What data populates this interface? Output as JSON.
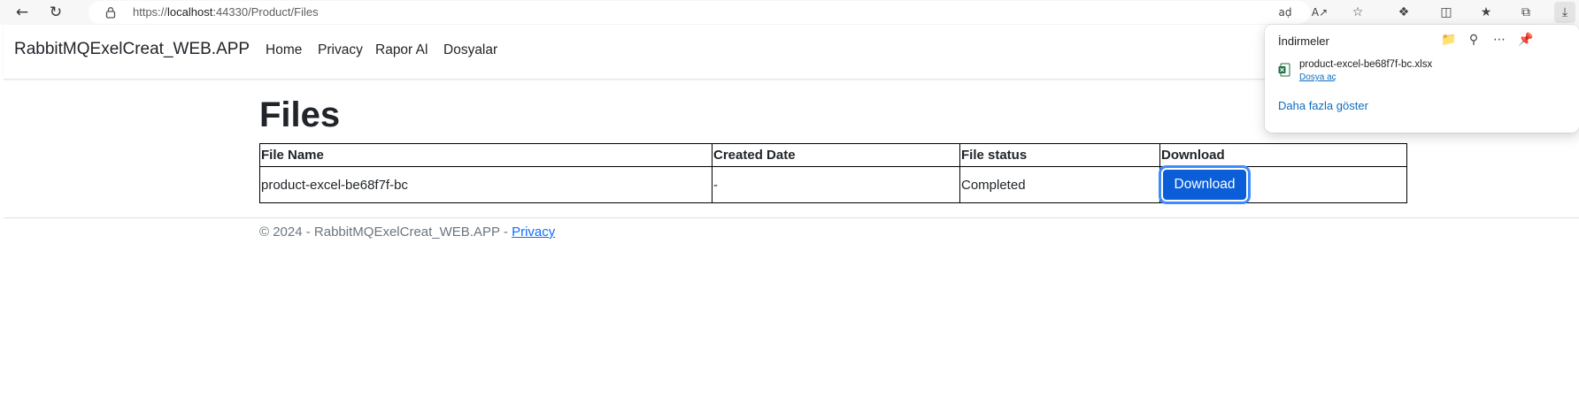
{
  "browser": {
    "url_prefix": "https://",
    "url_host": "localhost",
    "url_path": ":44330/Product/Files"
  },
  "navbar": {
    "brand": "RabbitMQExelCreat_WEB.APP",
    "links": [
      "Home",
      "Privacy",
      "Rapor Al",
      "Dosyalar"
    ]
  },
  "main": {
    "title": "Files",
    "table": {
      "headers": [
        "File Name",
        "Created Date",
        "File status",
        "Download"
      ],
      "rows": [
        {
          "file_name": "product-excel-be68f7f-bc",
          "created_date": "-",
          "status": "Completed",
          "download_label": "Download"
        }
      ]
    }
  },
  "footer": {
    "text": "© 2024 - RabbitMQExelCreat_WEB.APP - ",
    "privacy_link": "Privacy"
  },
  "downloads_panel": {
    "title": "İndirmeler",
    "items": [
      {
        "file_name": "product-excel-be68f7f-bc.xlsx",
        "open_label": "Dosya aç"
      }
    ],
    "more_label": "Daha fazla göster"
  },
  "colors": {
    "primary_button": "#0b5ed7",
    "link": "#0d6efd",
    "edge_link": "#0f6cbd",
    "excel_green": "#1d6f42"
  }
}
